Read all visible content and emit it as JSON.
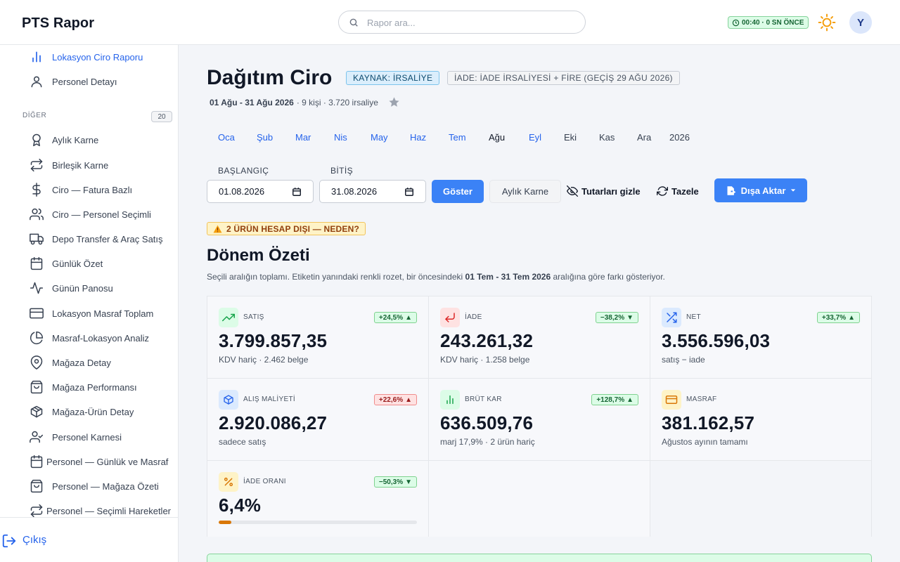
{
  "app": {
    "brand": "PTS Rapor"
  },
  "search": {
    "placeholder": "Rapor ara..."
  },
  "header": {
    "clock": "00:40 · 0 SN ÖNCE",
    "avatar": "Y"
  },
  "sidebar": {
    "top_items": [
      {
        "label": "Lokasyon Ciro Raporu",
        "icon": "bar-chart-icon"
      },
      {
        "label": "Personel Detayı",
        "icon": "user-icon"
      }
    ],
    "section_title": "DİĞER",
    "section_count": "20",
    "items": [
      {
        "label": "Aylık Karne",
        "icon": "award-icon"
      },
      {
        "label": "Birleşik Karne",
        "icon": "repeat-icon"
      },
      {
        "label": "Ciro — Fatura Bazlı",
        "icon": "dollar-icon"
      },
      {
        "label": "Ciro — Personel Seçimli",
        "icon": "users-icon"
      },
      {
        "label": "Depo Transfer & Araç Satış",
        "icon": "truck-icon"
      },
      {
        "label": "Günlük Özet",
        "icon": "calendar-icon"
      },
      {
        "label": "Günün Panosu",
        "icon": "activity-icon"
      },
      {
        "label": "Lokasyon Masraf Toplam",
        "icon": "credit-card-icon"
      },
      {
        "label": "Masraf-Lokasyon Analiz",
        "icon": "pie-chart-icon"
      },
      {
        "label": "Mağaza Detay",
        "icon": "map-pin-icon"
      },
      {
        "label": "Mağaza Performansı",
        "icon": "shopping-bag-icon"
      },
      {
        "label": "Mağaza-Ürün Detay",
        "icon": "package-icon"
      },
      {
        "label": "Personel Karnesi",
        "icon": "user-check-icon"
      },
      {
        "label": "Personel — Günlük ve Masraf",
        "icon": "calendar-icon"
      },
      {
        "label": "Personel — Mağaza Özeti",
        "icon": "shopping-bag-icon"
      },
      {
        "label": "Personel — Seçimli Hareketler",
        "icon": "repeat-icon"
      }
    ],
    "logout": "Çıkış"
  },
  "page": {
    "title": "Dağıtım Ciro",
    "tag_source": "KAYNAK: İRSALİYE",
    "tag_iade": "İADE: İADE İRSALİYESİ + FİRE (GEÇİŞ 29 AĞU 2026)",
    "period": "01 Ağu - 31 Ağu 2026",
    "people": "· 9 kişi · 3.720 irsaliye",
    "months": [
      "Oca",
      "Şub",
      "Mar",
      "Nis",
      "May",
      "Haz",
      "Tem",
      "Ağu",
      "Eyl",
      "Eki",
      "Kas",
      "Ara"
    ],
    "selected_month": "Ağu",
    "year": "2026",
    "start_label": "BAŞLANGIÇ",
    "end_label": "BİTİŞ",
    "start_value": "01.08.2026",
    "end_value": "31.08.2026",
    "btn_show": "Göster",
    "btn_monthly": "Aylık Karne",
    "btn_hide": "Tutarları gizle",
    "btn_refresh": "Tazele",
    "btn_export": "Dışa Aktar",
    "warning": "2 ÜRÜN HESAP DIŞI — NEDEN?",
    "summary_title": "Dönem Özeti",
    "summary_desc_pre": "Seçili aralığın toplamı. Etiketin yanındaki renkli rozet, bir öncesindeki ",
    "summary_desc_range": "01 Tem - 31 Tem 2026",
    "summary_desc_post": " aralığına göre farkı gösteriyor."
  },
  "cards": [
    {
      "label": "SATIŞ",
      "value": "3.799.857,35",
      "sub": "KDV hariç · 2.462 belge",
      "delta": "+24,5%",
      "arrow": "▲",
      "icon": "trending-up-icon",
      "icon_bg": "#dcfce7",
      "icon_color": "#16a34a"
    },
    {
      "label": "İADE",
      "value": "243.261,32",
      "sub": "KDV hariç · 1.258 belge",
      "delta": "−38,2%",
      "arrow": "▼",
      "icon": "return-arrow-icon",
      "icon_bg": "#fee2e2",
      "icon_color": "#dc2626"
    },
    {
      "label": "NET",
      "value": "3.556.596,03",
      "sub": "satış − iade",
      "delta": "+33,7%",
      "arrow": "▲",
      "icon": "shuffle-icon",
      "icon_bg": "#dbeafe",
      "icon_color": "#2563eb"
    },
    {
      "label": "ALIŞ MALİYETİ",
      "value": "2.920.086,27",
      "sub": "sadece satış",
      "delta": "+22,6%",
      "arrow": "▲",
      "icon": "box-icon",
      "icon_bg": "#dbeafe",
      "icon_color": "#2563eb"
    },
    {
      "label": "BRÜT KAR",
      "value": "636.509,76",
      "sub": "marj 17,9% · 2 ürün hariç",
      "delta": "+128,7%",
      "arrow": "▲",
      "icon": "bar-chart-icon",
      "icon_bg": "#dcfce7",
      "icon_color": "#16a34a"
    },
    {
      "label": "MASRAF",
      "value": "381.162,57",
      "sub": "Ağustos ayının tamamı",
      "delta": "",
      "arrow": "",
      "icon": "wallet-icon",
      "icon_bg": "#fef3c7",
      "icon_color": "#d97706"
    },
    {
      "label": "İADE ORANI",
      "value": "6,4%",
      "sub": "",
      "delta": "−50,3%",
      "arrow": "▼",
      "icon": "percent-icon",
      "icon_bg": "#fef3c7",
      "icon_color": "#d97706",
      "progress": 0.064
    }
  ]
}
